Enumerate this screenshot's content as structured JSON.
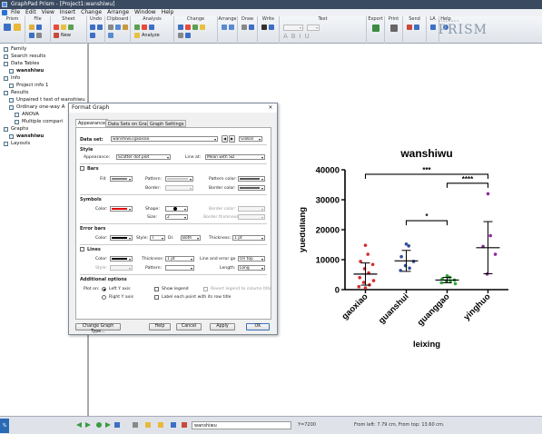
{
  "window": {
    "title": "GraphPad Prism - [Project1:wanshiwu]"
  },
  "menu": [
    "File",
    "Edit",
    "View",
    "Insert",
    "Change",
    "Arrange",
    "Window",
    "Help"
  ],
  "ribbon": {
    "groups": [
      "Prism",
      "File",
      "Sheet",
      "Undo",
      "Clipboard",
      "Analysis",
      "Change",
      "Arrange",
      "Draw",
      "Write",
      "Text",
      "Export",
      "Print",
      "Send",
      "LA",
      "Help"
    ],
    "new_label": "New",
    "analyze_label": "Analyze",
    "brand": "PRISM",
    "brand_small": "GraphPad"
  },
  "navigator": {
    "items": [
      {
        "label": "Family",
        "bold": false,
        "indent": 0
      },
      {
        "label": "Search results",
        "bold": false,
        "indent": 0
      },
      {
        "label": "Data Tables",
        "bold": false,
        "indent": 0
      },
      {
        "label": "wanshiwu",
        "bold": true,
        "indent": 1
      },
      {
        "label": "Info",
        "bold": false,
        "indent": 0
      },
      {
        "label": "Project info 1",
        "bold": false,
        "indent": 1
      },
      {
        "label": "Results",
        "bold": false,
        "indent": 0
      },
      {
        "label": "Unpaired t test of wanshiwu",
        "bold": false,
        "indent": 1
      },
      {
        "label": "Ordinary one-way A",
        "bold": false,
        "indent": 1
      },
      {
        "label": "ANOVA",
        "bold": false,
        "indent": 2
      },
      {
        "label": "Multiple compari",
        "bold": false,
        "indent": 2
      },
      {
        "label": "Graphs",
        "bold": false,
        "indent": 0
      },
      {
        "label": "wanshiwu",
        "bold": true,
        "indent": 1
      },
      {
        "label": "Layouts",
        "bold": false,
        "indent": 0
      }
    ]
  },
  "dialog": {
    "title": "Format Graph",
    "close": "✕",
    "tabs": [
      "Appearance",
      "Data Sets on Graph",
      "Graph Settings"
    ],
    "dataset_label": "Data set:",
    "dataset_value": "wanshiwu:gaoxiao",
    "global_label": "Global",
    "style_heading": "Style",
    "appearance_label": "Appearance:",
    "appearance_value": "Scatter dot plot",
    "lineat_label": "Line at:",
    "lineat_value": "Mean with SD",
    "bars_heading": "Bars",
    "fill_label": "Fill:",
    "pattern_label": "Pattern:",
    "pattern_color_label": "Pattern color:",
    "border_label": "Border:",
    "border_color_label": "Border color:",
    "symbols_heading": "Symbols",
    "color_label": "Color:",
    "shape_label": "Shape:",
    "size_label": "Size:",
    "size_value": "2",
    "border_thickness_label": "Border thickness:",
    "errorbars_heading": "Error bars",
    "style_label": "Style:",
    "style_glyph": "T",
    "dir_label": "Di:",
    "dir_value": "Both",
    "thickness_label": "Thickness:",
    "thickness_value": "1 pt",
    "lines_heading": "Lines",
    "lines_thickness_value": "1 pt",
    "line_error_label": "Line and error go",
    "line_error_value": "On top",
    "length_label": "Length:",
    "length_value": "Long",
    "additional_heading": "Additional options",
    "ploton_label": "Plot on:",
    "left_axis_label": "Left Y axis",
    "right_axis_label": "Right Y axis",
    "show_legend_label": "Show legend",
    "revert_legend_label": "Revert legend to column title",
    "label_each_label": "Label each point with its row title",
    "buttons": {
      "change_type": "Change Graph Type...",
      "help": "Help",
      "cancel": "Cancel",
      "apply": "Apply",
      "ok": "OK"
    },
    "colors": {
      "fill": "#808080",
      "symbol": "#e00000",
      "errorbar": "#000000",
      "line": "#000000",
      "border_color": "#555555",
      "pattern_color": "#555555"
    }
  },
  "statusbar": {
    "sheet_tab": "wanshiwu",
    "coord": "Y=7200",
    "position": "From left: 7.79 cm, From top: 13.60 cm."
  },
  "chart_data": {
    "type": "scatter",
    "title": "wanshiwu",
    "xlabel": "leixing",
    "ylabel": "yueduliang",
    "categories": [
      "gaoxiao",
      "guanshui",
      "guanggao",
      "yinghuo"
    ],
    "ylim": [
      0,
      40000
    ],
    "yticks": [
      0,
      10000,
      20000,
      30000,
      40000
    ],
    "series": [
      {
        "name": "gaoxiao",
        "color": "#d62b2b",
        "values": [
          14800,
          11800,
          9400,
          8400,
          7000,
          5600,
          4000,
          3000,
          2400,
          1600,
          1000,
          600
        ],
        "mean": 5200,
        "sd": 3700
      },
      {
        "name": "guanshui",
        "color": "#2f4f99",
        "values": [
          15200,
          14600,
          11000,
          9400,
          8000,
          7200,
          6400
        ],
        "mean": 9600,
        "sd": 3500
      },
      {
        "name": "guanggao",
        "color": "#2eaa3a",
        "values": [
          4600,
          4100,
          3600,
          3200,
          2900,
          2600,
          2300,
          2000
        ],
        "mean": 3200,
        "sd": 900
      },
      {
        "name": "yinghuo",
        "color": "#8e2a9e",
        "values": [
          32000,
          18000,
          14400,
          11800,
          5200
        ],
        "mean": 14000,
        "sd": 8700
      }
    ],
    "significance": [
      {
        "from": 0,
        "to": 3,
        "label": "***",
        "y": 38500
      },
      {
        "from": 2,
        "to": 3,
        "label": "****",
        "y": 35500
      },
      {
        "from": 1,
        "to": 2,
        "label": "*",
        "y": 23000
      }
    ]
  }
}
